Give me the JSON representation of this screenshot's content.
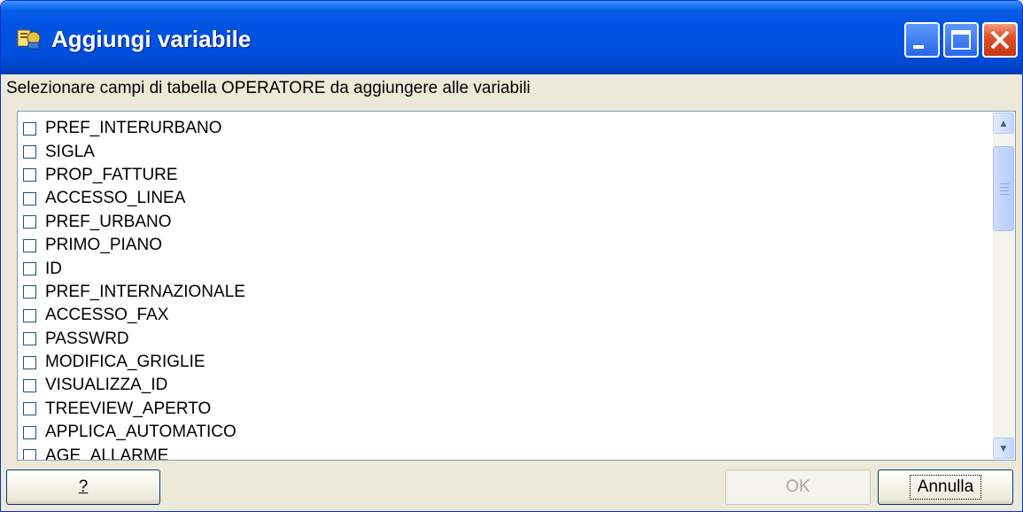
{
  "window": {
    "title": "Aggiungi variabile",
    "icon": "app-icon"
  },
  "prompt": "Selezionare campi di tabella OPERATORE da aggiungere alle variabili",
  "fields": [
    {
      "label": "PREF_INTERURBANO",
      "checked": false
    },
    {
      "label": "SIGLA",
      "checked": false
    },
    {
      "label": "PROP_FATTURE",
      "checked": false
    },
    {
      "label": "ACCESSO_LINEA",
      "checked": false
    },
    {
      "label": "PREF_URBANO",
      "checked": false
    },
    {
      "label": "PRIMO_PIANO",
      "checked": false
    },
    {
      "label": "ID",
      "checked": false
    },
    {
      "label": "PREF_INTERNAZIONALE",
      "checked": false
    },
    {
      "label": "ACCESSO_FAX",
      "checked": false
    },
    {
      "label": "PASSWRD",
      "checked": false
    },
    {
      "label": "MODIFICA_GRIGLIE",
      "checked": false
    },
    {
      "label": "VISUALIZZA_ID",
      "checked": false
    },
    {
      "label": "TREEVIEW_APERTO",
      "checked": false
    },
    {
      "label": "APPLICA_AUTOMATICO",
      "checked": false
    },
    {
      "label": "AGE_ALLARME",
      "checked": false
    }
  ],
  "buttons": {
    "help": "?",
    "ok": "OK",
    "cancel": "Annulla"
  },
  "colors": {
    "titlebar": "#0054e3",
    "dialog_bg": "#ece9d8",
    "list_border": "#7f9db9"
  }
}
